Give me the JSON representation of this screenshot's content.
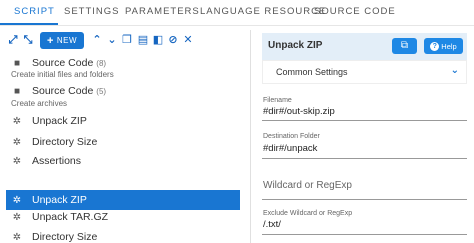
{
  "tabs": {
    "script": "SCRIPT",
    "settings": "SETTINGS",
    "parameters": "PARAMETERS",
    "language_resource": "LANGUAGE RESOURCE",
    "source_code": "SOURCE CODE"
  },
  "toolbar": {
    "new_label": "NEW"
  },
  "tree": {
    "items": [
      {
        "label": "Source Code",
        "count": "(8)",
        "sub": "Create initial files and folders",
        "icon": "folder-icon"
      },
      {
        "label": "Source Code",
        "count": "(5)",
        "sub": "Create archives",
        "icon": "folder-icon"
      },
      {
        "label": "Unpack ZIP",
        "icon": "gear-icon"
      },
      {
        "label": "Directory Size",
        "icon": "gear-icon"
      },
      {
        "label": "Assertions",
        "icon": "gear-icon"
      },
      {
        "label": "Unpack ZIP",
        "icon": "gear-icon",
        "selected": true
      },
      {
        "label": "Unpack TAR.GZ",
        "icon": "gear-icon"
      },
      {
        "label": "Directory Size",
        "icon": "gear-icon"
      }
    ]
  },
  "panel": {
    "title": "Unpack ZIP",
    "help_label": "Help",
    "common_settings": "Common Settings",
    "filename_label": "Filename",
    "filename_value": "#dir#/out-skip.zip",
    "dest_label": "Destination Folder",
    "dest_value": "#dir#/unpack",
    "wildcard_placeholder": "Wildcard or RegExp",
    "exclude_label": "Exclude Wildcard or RegExp",
    "exclude_value": "/.txt/"
  },
  "colors": {
    "accent": "#1976d2",
    "panel_header_bg": "#e3eef8"
  }
}
